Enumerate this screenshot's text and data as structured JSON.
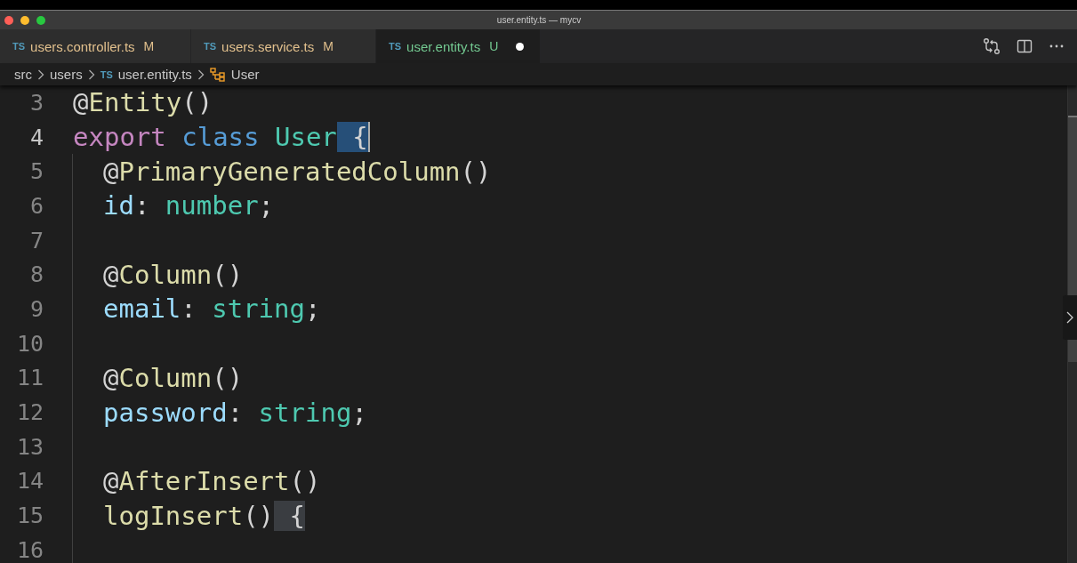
{
  "window": {
    "title": "user.entity.ts — mycv"
  },
  "tabs": [
    {
      "badge": "TS",
      "label": "users.controller.ts",
      "status": "M",
      "selected": false,
      "dirty": false
    },
    {
      "badge": "TS",
      "label": "users.service.ts",
      "status": "M",
      "selected": false,
      "dirty": false
    },
    {
      "badge": "TS",
      "label": "user.entity.ts",
      "status": "U",
      "selected": true,
      "dirty": true
    }
  ],
  "breadcrumbs": [
    {
      "kind": "folder",
      "label": "src"
    },
    {
      "kind": "folder",
      "label": "users"
    },
    {
      "kind": "file",
      "badge": "TS",
      "label": "user.entity.ts"
    },
    {
      "kind": "symbol",
      "label": "User"
    }
  ],
  "editor": {
    "lines": [
      {
        "number": "3",
        "current": false,
        "indent": false,
        "tokens": [
          {
            "kind": "plain",
            "text": "@"
          },
          {
            "kind": "function",
            "text": "Entity"
          },
          {
            "kind": "plain",
            "text": "()"
          }
        ]
      },
      {
        "number": "4",
        "current": true,
        "indent": false,
        "tokens": [
          {
            "kind": "keyword",
            "text": "export "
          },
          {
            "kind": "storage",
            "text": "class "
          },
          {
            "kind": "class",
            "text": "User"
          },
          {
            "kind": "selection",
            "text": " {"
          }
        ]
      },
      {
        "number": "5",
        "current": false,
        "indent": true,
        "tokens": [
          {
            "kind": "plain",
            "text": "@"
          },
          {
            "kind": "function",
            "text": "PrimaryGeneratedColumn"
          },
          {
            "kind": "plain",
            "text": "()"
          }
        ]
      },
      {
        "number": "6",
        "current": false,
        "indent": true,
        "tokens": [
          {
            "kind": "property",
            "text": "id"
          },
          {
            "kind": "plain",
            "text": ": "
          },
          {
            "kind": "class",
            "text": "number"
          },
          {
            "kind": "plain",
            "text": ";"
          }
        ]
      },
      {
        "number": "7",
        "current": false,
        "indent": true
      },
      {
        "number": "8",
        "current": false,
        "indent": true,
        "tokens": [
          {
            "kind": "plain",
            "text": "@"
          },
          {
            "kind": "function",
            "text": "Column"
          },
          {
            "kind": "plain",
            "text": "()"
          }
        ]
      },
      {
        "number": "9",
        "current": false,
        "indent": true,
        "tokens": [
          {
            "kind": "property",
            "text": "email"
          },
          {
            "kind": "plain",
            "text": ": "
          },
          {
            "kind": "class",
            "text": "string"
          },
          {
            "kind": "plain",
            "text": ";"
          }
        ]
      },
      {
        "number": "10",
        "current": false,
        "indent": true
      },
      {
        "number": "11",
        "current": false,
        "indent": true,
        "tokens": [
          {
            "kind": "plain",
            "text": "@"
          },
          {
            "kind": "function",
            "text": "Column"
          },
          {
            "kind": "plain",
            "text": "()"
          }
        ]
      },
      {
        "number": "12",
        "current": false,
        "indent": true,
        "tokens": [
          {
            "kind": "property",
            "text": "password"
          },
          {
            "kind": "plain",
            "text": ": "
          },
          {
            "kind": "class",
            "text": "string"
          },
          {
            "kind": "plain",
            "text": ";"
          }
        ]
      },
      {
        "number": "13",
        "current": false,
        "indent": true
      },
      {
        "number": "14",
        "current": false,
        "indent": true,
        "tokens": [
          {
            "kind": "plain",
            "text": "@"
          },
          {
            "kind": "function",
            "text": "AfterInsert"
          },
          {
            "kind": "plain",
            "text": "()"
          }
        ]
      },
      {
        "number": "15",
        "current": false,
        "indent": true,
        "tokens": [
          {
            "kind": "function",
            "text": "logInsert"
          },
          {
            "kind": "plain",
            "text": "()"
          },
          {
            "kind": "bracket-match",
            "text": " {"
          }
        ]
      },
      {
        "number": "16",
        "current": false,
        "indent": true
      }
    ]
  }
}
